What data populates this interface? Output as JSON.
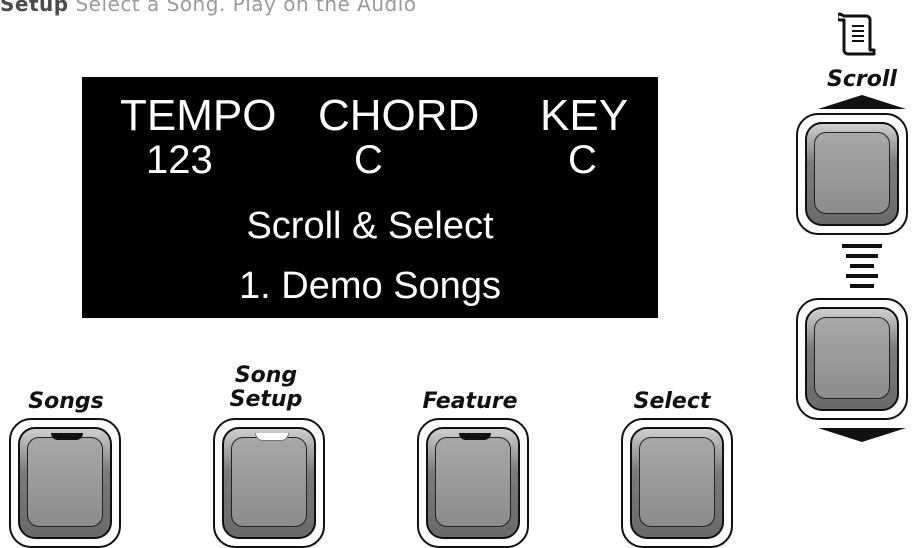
{
  "top_text": {
    "bold": "Setup",
    "rest": " Select a Song. Play on the Audio"
  },
  "display": {
    "labels": {
      "tempo": "TEMPO",
      "chord": "CHORD",
      "key": "KEY"
    },
    "values": {
      "tempo": "123",
      "chord": "C",
      "key": "C"
    },
    "line3": "Scroll & Select",
    "line4": "1. Demo Songs"
  },
  "buttons": {
    "songs": "Songs",
    "song_setup_1": "Song",
    "song_setup_2": "Setup",
    "feature": "Feature",
    "select": "Select"
  },
  "scroll": {
    "label": "Scroll",
    "icon": "scroll-document-icon"
  }
}
